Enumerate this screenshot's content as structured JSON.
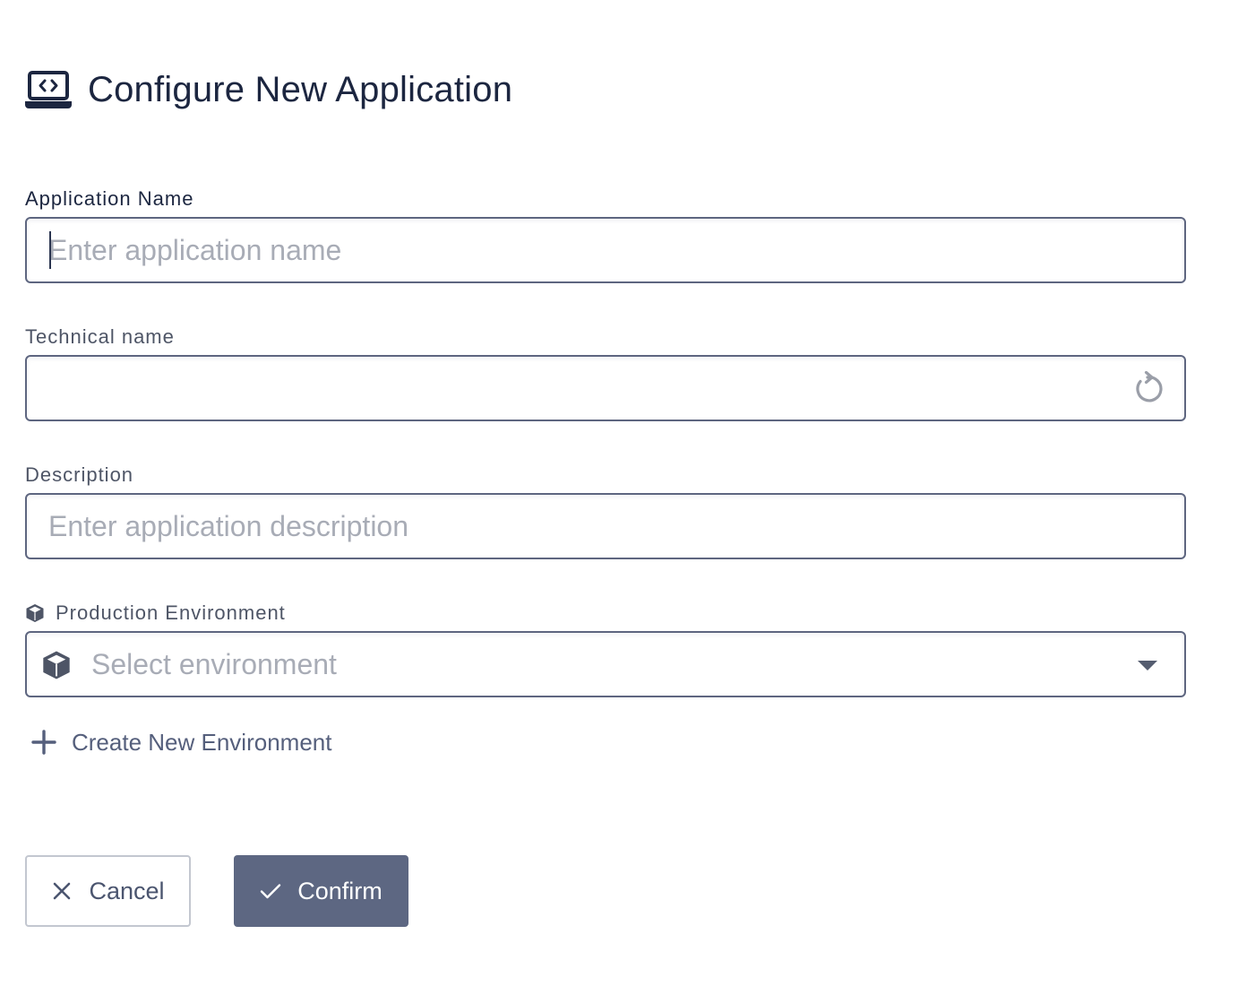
{
  "header": {
    "title": "Configure New Application",
    "icon": "laptop-code-icon"
  },
  "fields": {
    "application_name": {
      "label": "Application Name",
      "value": "",
      "placeholder": "Enter application name"
    },
    "technical_name": {
      "label": "Technical name",
      "value": "",
      "placeholder": "",
      "action_icon": "reset-icon"
    },
    "description": {
      "label": "Description",
      "value": "",
      "placeholder": "Enter application description"
    },
    "production_environment": {
      "label": "Production Environment",
      "label_icon": "cube-icon",
      "placeholder": "Select environment",
      "selected_value": ""
    }
  },
  "create_environment": {
    "label": "Create New Environment",
    "icon": "plus-icon"
  },
  "actions": {
    "cancel_label": "Cancel",
    "cancel_icon": "close-icon",
    "confirm_label": "Confirm",
    "confirm_icon": "check-icon"
  },
  "colors": {
    "title_text": "#1c2640",
    "input_border": "#5e6680",
    "placeholder": "#a8acb6",
    "link_text": "#555f7c",
    "confirm_bg": "#5d6782",
    "cancel_border": "#c3c7d0"
  }
}
